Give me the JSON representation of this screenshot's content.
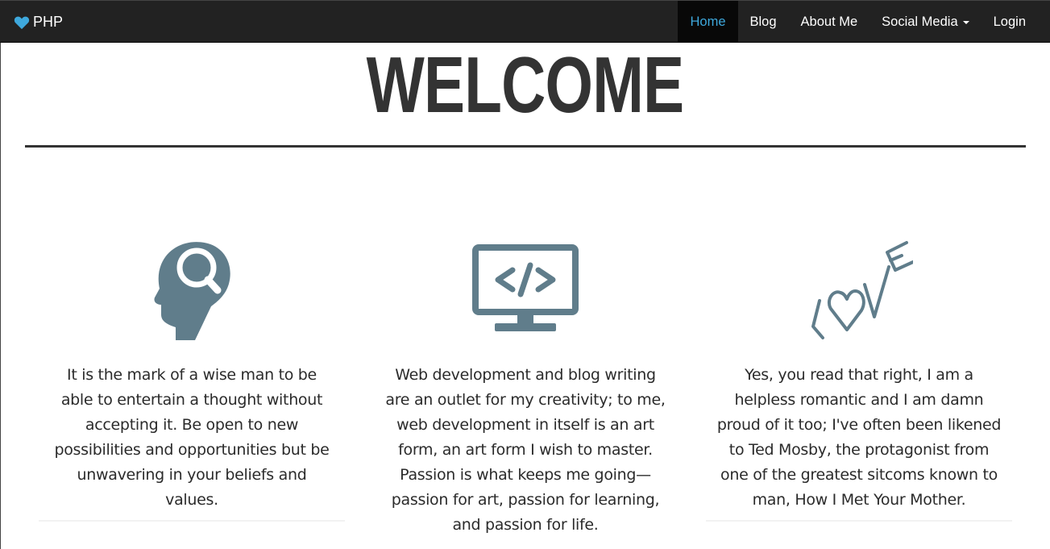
{
  "navbar": {
    "brand": "PHP",
    "items": [
      {
        "label": "Home",
        "active": true
      },
      {
        "label": "Blog",
        "active": false
      },
      {
        "label": "About Me",
        "active": false
      },
      {
        "label": "Social Media",
        "active": false,
        "dropdown": true
      },
      {
        "label": "Login",
        "active": false
      }
    ],
    "colors": {
      "background": "#222222",
      "active_text": "#3ea8dc",
      "brand_icon": "#3ea8dc"
    }
  },
  "hero": {
    "title": "WELCOME"
  },
  "features": [
    {
      "icon": "head-magnifier-icon",
      "text": "It is the mark of a wise man to be able to entertain a thought without accepting it. Be open to new possibilities and opportunities but be unwavering in your beliefs and values."
    },
    {
      "icon": "monitor-code-icon",
      "text": "Web development and blog writing are an outlet for my creativity; to me, web development in itself is an art form, an art form I wish to master. Passion is what keeps me going—passion for art, passion for learning, and passion for life."
    },
    {
      "icon": "love-icon",
      "text": "Yes, you read that right, I am a helpless romantic and I am damn proud of it too; I've often been likened to Ted Mosby, the protagonist from one of the greatest sitcoms known to man, How I Met Your Mother."
    }
  ],
  "icon_color": "#607d8b"
}
